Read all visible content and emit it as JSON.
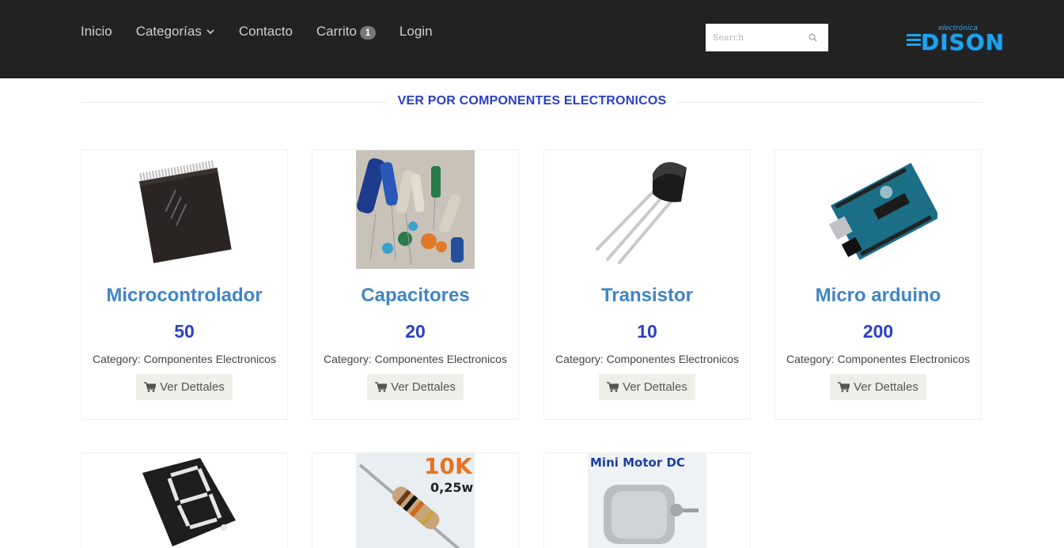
{
  "nav": {
    "items": [
      {
        "label": "Inicio"
      },
      {
        "label": "Categorías"
      },
      {
        "label": "Contacto"
      },
      {
        "label": "Carrito"
      },
      {
        "label": "Login"
      }
    ],
    "cart_count": "1"
  },
  "search": {
    "placeholder": "Search"
  },
  "logo": {
    "small": "electrónica",
    "big": "DISON"
  },
  "section": {
    "title": "VER POR COMPONENTES ELECTRONICOS"
  },
  "products": [
    {
      "name": "Microcontrolador",
      "price": "50",
      "category": "Category: Componentes Electronicos",
      "button": "Ver Dettales"
    },
    {
      "name": "Capacitores",
      "price": "20",
      "category": "Category: Componentes Electronicos",
      "button": "Ver Dettales"
    },
    {
      "name": "Transistor",
      "price": "10",
      "category": "Category: Componentes Electronicos",
      "button": "Ver Dettales"
    },
    {
      "name": "Micro arduino",
      "price": "200",
      "category": "Category: Componentes Electronicos",
      "button": "Ver Dettales"
    }
  ],
  "row2_images": {
    "resistor_label": "10K",
    "resistor_watt": "0,25w",
    "motor_label": "Mini Motor DC"
  },
  "colors": {
    "header_bg": "#222222",
    "accent_blue": "#2a3fc5",
    "name_blue": "#3f85c6",
    "button_bg": "#efefe9"
  }
}
